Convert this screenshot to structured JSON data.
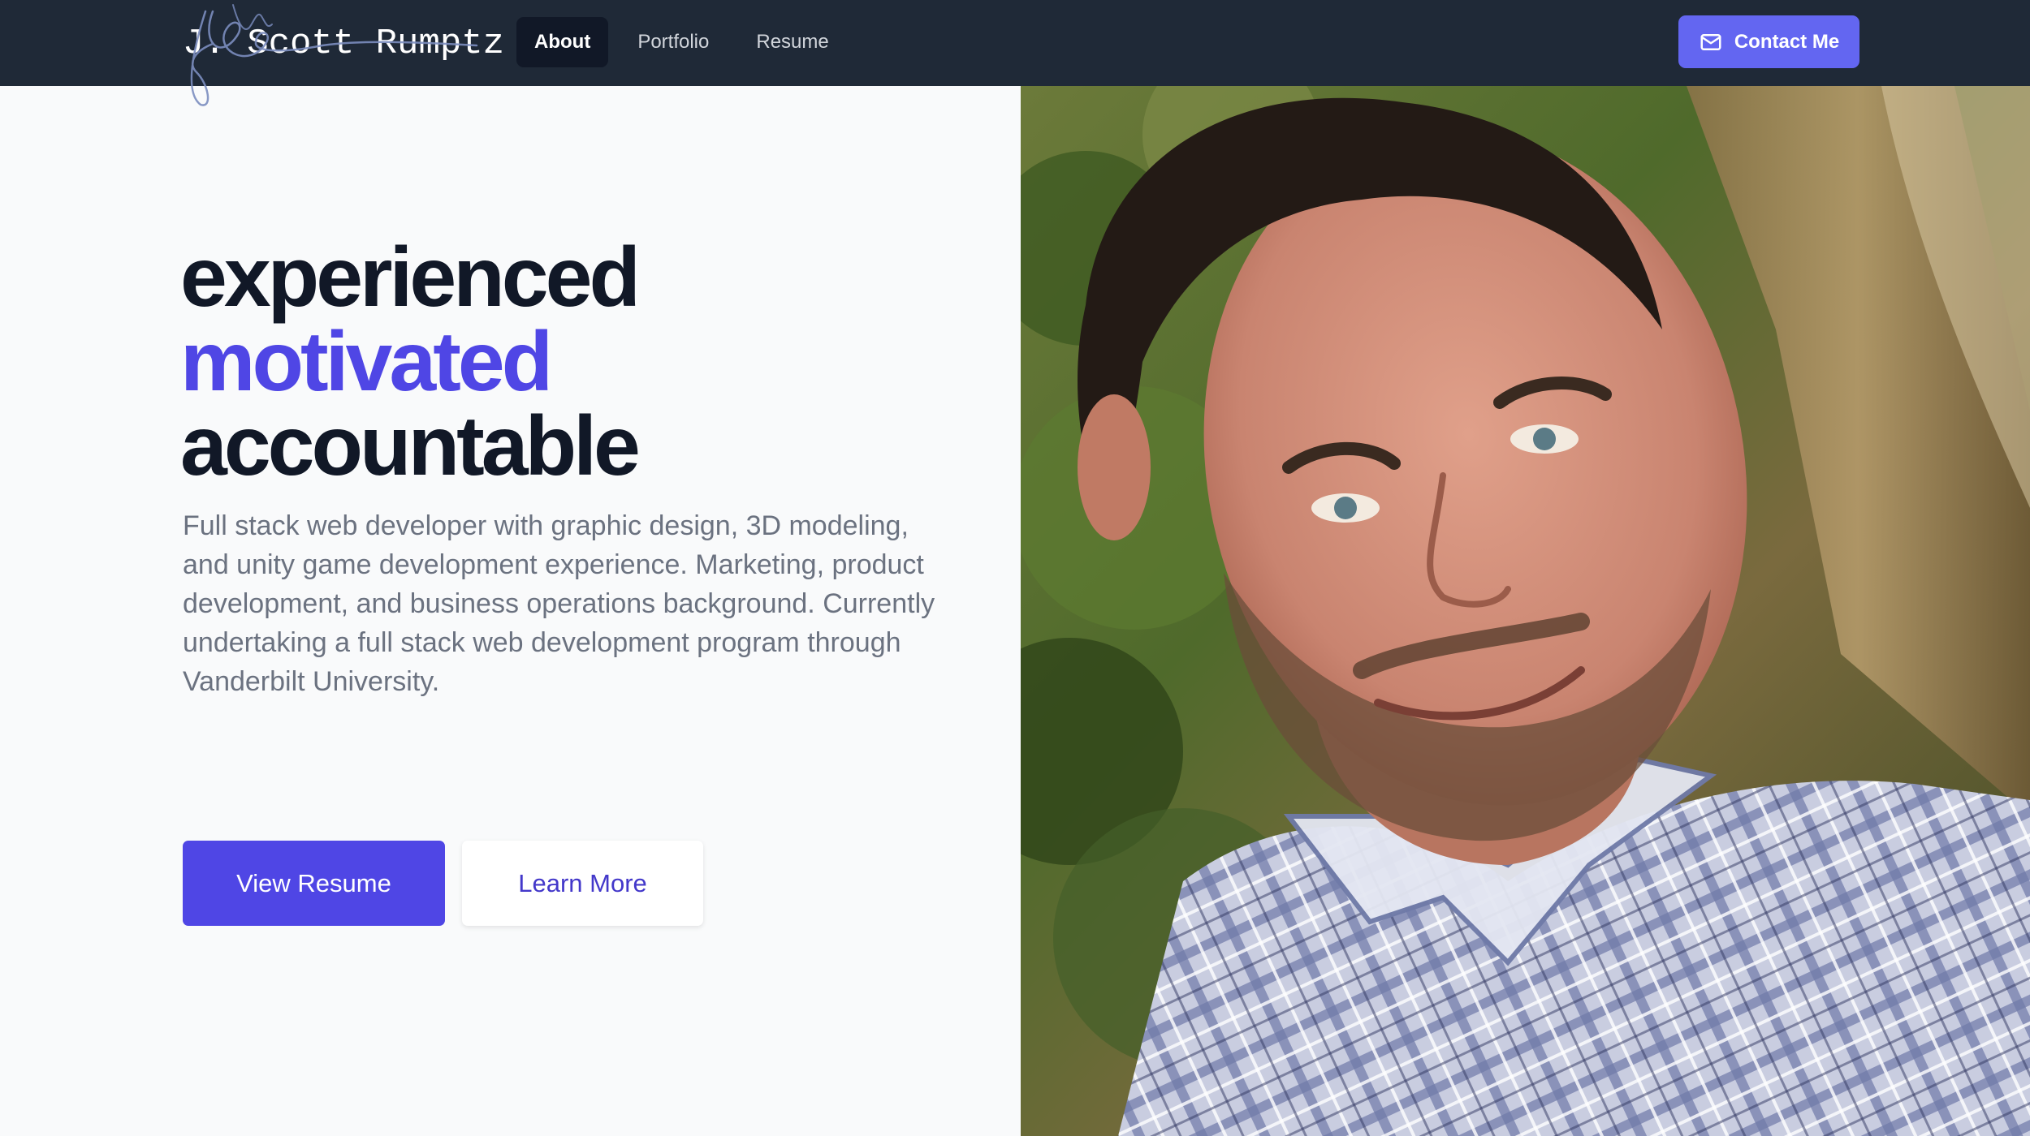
{
  "nav": {
    "brand": "J. Scott Rumptz",
    "links": [
      {
        "label": "About",
        "active": true
      },
      {
        "label": "Portfolio",
        "active": false
      },
      {
        "label": "Resume",
        "active": false
      }
    ],
    "contact_label": "Contact Me",
    "contact_icon": "envelope-icon"
  },
  "hero": {
    "headline": [
      "experienced",
      "motivated",
      "accountable"
    ],
    "intro": "Full stack web developer with graphic design, 3D modeling, and unity game development experience. Marketing, product development, and business operations background. Currently undertaking a full stack web development program through Vanderbilt University.",
    "primary_button": "View Resume",
    "secondary_button": "Learn More"
  },
  "colors": {
    "nav_bg": "#1f2937",
    "accent": "#4f46e5",
    "contact_bg": "#6366f1",
    "headline": "#111827",
    "body_text": "#6b7280",
    "page_bg": "#f9fafb"
  }
}
